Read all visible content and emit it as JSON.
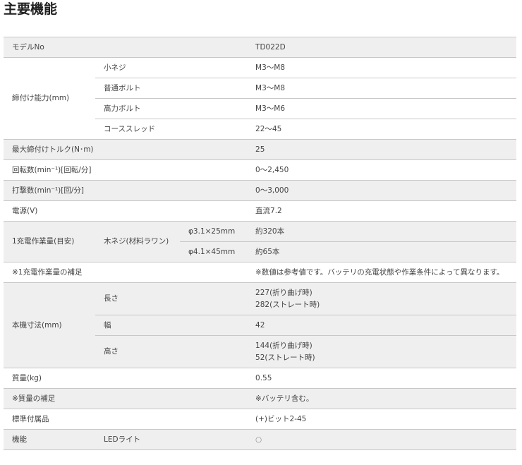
{
  "title": "主要機能",
  "rows": {
    "model": {
      "label": "モデルNo",
      "value": "TD022D"
    },
    "capacity": {
      "label": "締付け能力(mm)",
      "items": [
        {
          "label": "小ネジ",
          "value": "M3～M8"
        },
        {
          "label": "普通ボルト",
          "value": "M3～M8"
        },
        {
          "label": "高力ボルト",
          "value": "M3～M6"
        },
        {
          "label": "コーススレッド",
          "value": "22～45"
        }
      ]
    },
    "torque": {
      "label": "最大締付けトルク(N･m)",
      "value": "25"
    },
    "rpm": {
      "label": "回転数(min⁻¹)[回転/分]",
      "value": "0～2,450"
    },
    "ipm": {
      "label": "打撃数(min⁻¹)[回/分]",
      "value": "0～3,000"
    },
    "power": {
      "label": "電源(V)",
      "value": "直流7.2"
    },
    "work": {
      "label": "1充電作業量(目安)",
      "sub": "木ネジ(材料ラワン)",
      "items": [
        {
          "label": "φ3.1×25mm",
          "value": "約320本"
        },
        {
          "label": "φ4.1×45mm",
          "value": "約65本"
        }
      ]
    },
    "work_note": {
      "label": "※1充電作業量の補足",
      "value": "※数値は参考値です。バッテリの充電状態や作業条件によって異なります。"
    },
    "dims": {
      "label": "本機寸法(mm)",
      "items": [
        {
          "label": "長さ",
          "value1": "227(折り曲げ時)",
          "value2": "282(ストレート時)"
        },
        {
          "label": "幅",
          "value1": "42"
        },
        {
          "label": "高さ",
          "value1": "144(折り曲げ時)",
          "value2": "52(ストレート時)"
        }
      ]
    },
    "mass": {
      "label": "質量(kg)",
      "value": "0.55"
    },
    "mass_note": {
      "label": "※質量の補足",
      "value": "※バッテリ含む。"
    },
    "accessory": {
      "label": "標準付属品",
      "value": "(+)ビット2-45"
    },
    "feature": {
      "label": "機能",
      "sub": "LEDライト",
      "value": "○"
    }
  }
}
